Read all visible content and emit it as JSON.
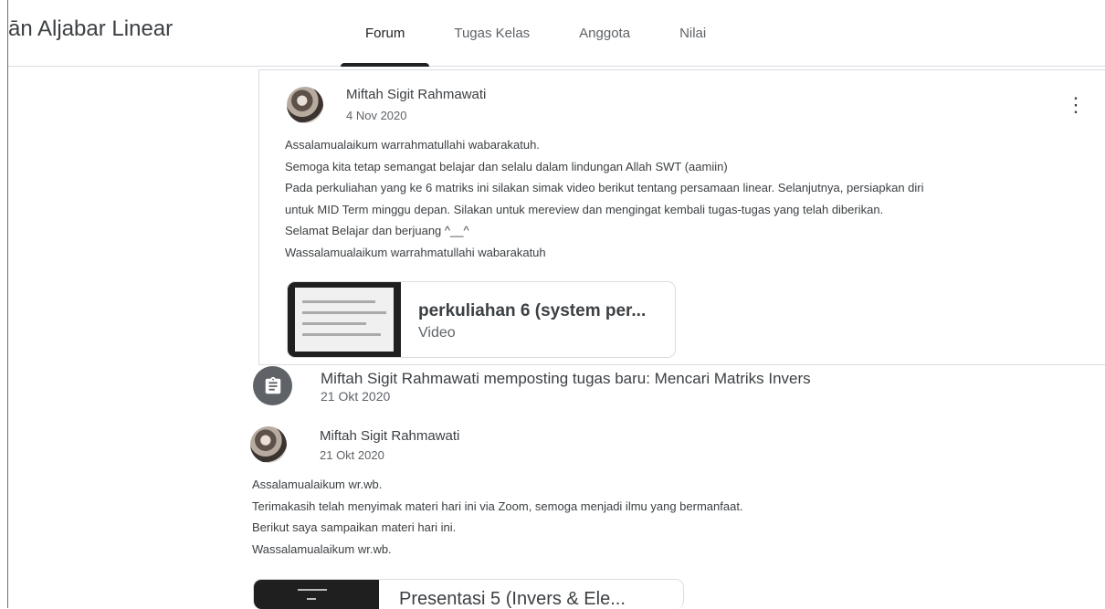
{
  "class_title": "ān Aljabar Linear",
  "tabs": [
    {
      "label": "Forum",
      "active": true
    },
    {
      "label": "Tugas Kelas"
    },
    {
      "label": "Anggota"
    },
    {
      "label": "Nilai"
    }
  ],
  "post1": {
    "author": "Miftah Sigit Rahmawati",
    "date": "4 Nov 2020",
    "lines": [
      "Assalamualaikum warrahmatullahi wabarakatuh.",
      "Semoga kita tetap semangat belajar dan selalu dalam lindungan Allah SWT (aamiin)",
      "Pada perkuliahan yang ke 6 matriks ini silakan simak video berikut tentang persamaan linear. Selanjutnya, persiapkan diri",
      "untuk MID Term minggu depan. Silakan untuk mereview dan mengingat kembali tugas-tugas yang telah diberikan.",
      "Selamat Belajar dan berjuang ^__^",
      "Wassalamualaikum warrahmatullahi wabarakatuh"
    ],
    "attachment": {
      "title": "perkuliahan 6 (system per...",
      "type": "Video"
    },
    "menu_icon": "more-vert-icon"
  },
  "assignment": {
    "text": "Miftah Sigit Rahmawati memposting tugas baru: Mencari Matriks Invers",
    "date": "21 Okt 2020",
    "icon": "assignment-icon"
  },
  "post2": {
    "author": "Miftah Sigit Rahmawati",
    "date": "21 Okt 2020",
    "lines": [
      "Assalamualaikum wr.wb.",
      "Terimakasih telah menyimak materi hari ini via Zoom, semoga menjadi ilmu yang bermanfaat.",
      "Berikut saya sampaikan materi hari ini.",
      "Wassalamualaikum wr.wb."
    ],
    "attachment": {
      "title": "Presentasi 5 (Invers & Ele..."
    }
  }
}
